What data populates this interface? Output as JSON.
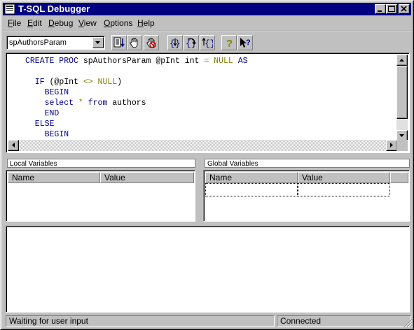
{
  "window": {
    "title": "T-SQL Debugger"
  },
  "menu": [
    {
      "label": "File",
      "accel": "F",
      "rest": "ile"
    },
    {
      "label": "Edit",
      "accel": "E",
      "rest": "dit"
    },
    {
      "label": "Debug",
      "accel": "D",
      "rest": "ebug"
    },
    {
      "label": "View",
      "accel": "V",
      "rest": "iew"
    },
    {
      "label": "Options",
      "accel": "O",
      "rest": "ptions"
    },
    {
      "label": "Help",
      "accel": "H",
      "rest": "elp"
    }
  ],
  "toolbar": {
    "procedure_select": "spAuthorsParam",
    "tools": [
      "go-icon",
      "breakpoint-hand-icon",
      "clear-breakpoints-icon",
      "step-into-icon",
      "step-over-icon",
      "step-out-icon",
      "help-icon",
      "context-help-icon"
    ]
  },
  "code": [
    {
      "parts": [
        {
          "t": "CREATE PROC",
          "c": "kw"
        },
        {
          "t": " spAuthorsParam @pInt int ",
          "c": ""
        },
        {
          "t": "=",
          "c": "op"
        },
        {
          "t": " ",
          "c": ""
        },
        {
          "t": "NULL",
          "c": "op"
        },
        {
          "t": " ",
          "c": ""
        },
        {
          "t": "AS",
          "c": "kw"
        }
      ]
    },
    {
      "parts": []
    },
    {
      "parts": [
        {
          "t": "  IF",
          "c": "kw"
        },
        {
          "t": " (@pInt ",
          "c": ""
        },
        {
          "t": "<>",
          "c": "op"
        },
        {
          "t": " ",
          "c": ""
        },
        {
          "t": "NULL",
          "c": "op"
        },
        {
          "t": ")",
          "c": ""
        }
      ]
    },
    {
      "parts": [
        {
          "t": "    BEGIN",
          "c": "kw"
        }
      ]
    },
    {
      "parts": [
        {
          "t": "    select",
          "c": "kw"
        },
        {
          "t": " ",
          "c": ""
        },
        {
          "t": "*",
          "c": "op"
        },
        {
          "t": " ",
          "c": ""
        },
        {
          "t": "from",
          "c": "kw"
        },
        {
          "t": " authors",
          "c": ""
        }
      ]
    },
    {
      "parts": [
        {
          "t": "    END",
          "c": "kw"
        }
      ]
    },
    {
      "parts": [
        {
          "t": "  ELSE",
          "c": "kw"
        }
      ]
    },
    {
      "parts": [
        {
          "t": "    BEGIN",
          "c": "kw"
        }
      ]
    }
  ],
  "local_vars": {
    "label": "Local Variables",
    "col_name": "Name",
    "col_value": "Value"
  },
  "global_vars": {
    "label": "Global Variables",
    "col_name": "Name",
    "col_value": "Value"
  },
  "status": {
    "message": "Waiting for user input",
    "connection": "Connected"
  }
}
